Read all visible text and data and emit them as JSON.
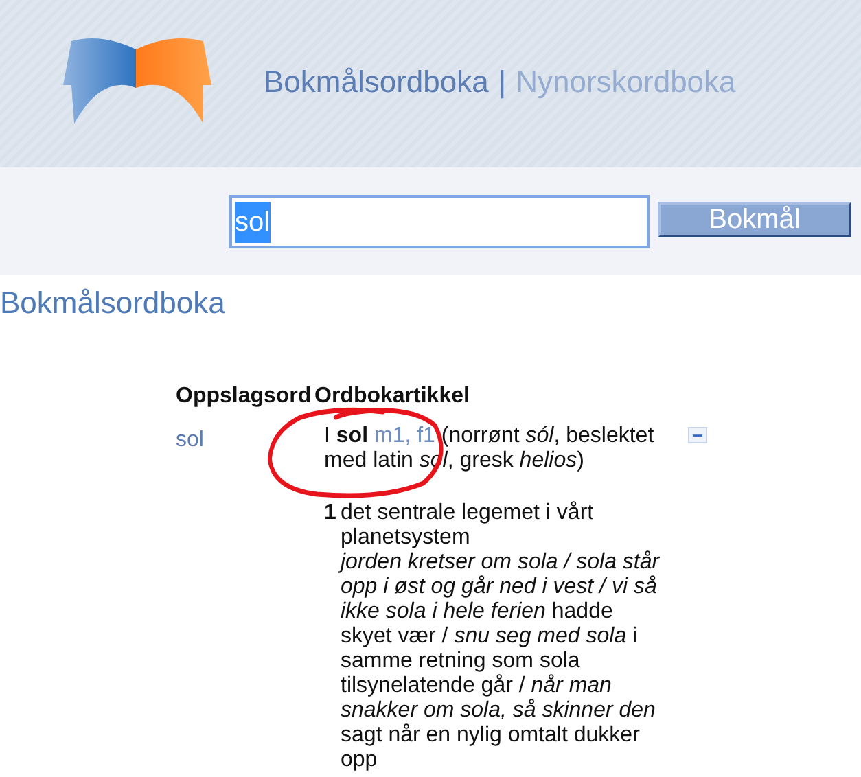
{
  "dictionaries": [
    {
      "label": "Bokmålsordboka",
      "selected": true
    },
    {
      "label": "Nynorskordboka",
      "selected": false
    }
  ],
  "separator": "|",
  "search": {
    "value": "sol",
    "text_selected": true,
    "button": "Bokmål"
  },
  "heading": "Bokmålsordboka",
  "table": {
    "columns": [
      "Oppslagsord",
      "Ordbokartikkel"
    ],
    "rows": [
      {
        "headword": "sol",
        "roman": "I",
        "lemma": "sol",
        "grammar": "m1, f1",
        "etymology": "(norrønt *sól*, beslektet med latin *sol*, gresk *helios*)",
        "collapse": "−",
        "expanded": true,
        "definitions": [
          {
            "number": "1",
            "text": "det sentrale legemet i vårt planetsystem",
            "examples": "*jorden kretser om sola / sola står opp i øst og går ned i vest / vi så ikke sola i hele ferien* hadde skyet vær / *snu seg med sola* i samme retning som sola tilsynelatende går / *når man snakker om sola, så skinner den* sagt når en nylig omtalt dukker opp"
          }
        ]
      }
    ]
  },
  "annotation": {
    "kind": "circle",
    "color": "#e8141b"
  }
}
